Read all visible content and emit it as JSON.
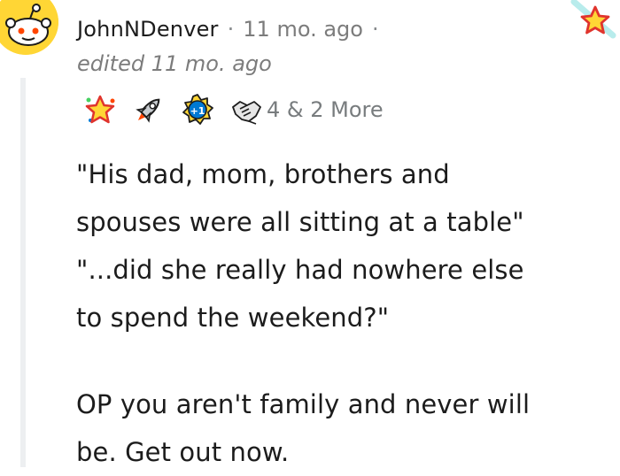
{
  "comment": {
    "author": "JohnNDenver",
    "separator": "·",
    "timestamp": "11 mo. ago",
    "edited": "edited 11 mo. ago",
    "awards": {
      "icons": [
        "starstruck-award-icon",
        "rocket-award-icon",
        "plus-one-award-icon",
        "handshake-award-icon"
      ],
      "count_text": "4 & 2 More"
    },
    "paragraphs": [
      [
        "\"His dad, mom, brothers and",
        "spouses were all sitting at a table\"",
        "\"...did she really had nowhere else",
        "to spend the weekend?\""
      ],
      [
        "OP you aren't family and never will",
        "be. Get out now."
      ]
    ]
  },
  "colors": {
    "avatar": "#ffd635",
    "thread_line": "#edeff1",
    "text": "#1c1c1c",
    "meta": "#7c7c7c"
  }
}
